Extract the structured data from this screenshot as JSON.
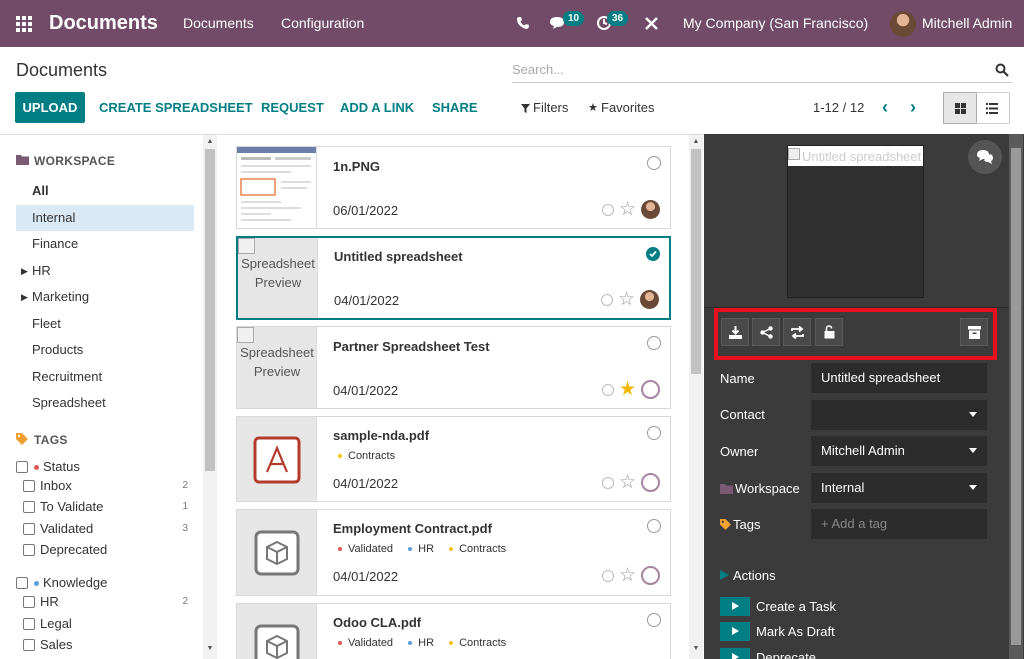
{
  "navbar": {
    "app_name": "Documents",
    "menu": [
      "Documents",
      "Configuration"
    ],
    "messages_count": "10",
    "activities_count": "36",
    "company": "My Company (San Francisco)",
    "user": "Mitchell Admin"
  },
  "control_panel": {
    "title": "Documents",
    "search_placeholder": "Search...",
    "upload_label": "UPLOAD",
    "links": [
      "CREATE SPREADSHEET",
      "REQUEST",
      "ADD A LINK",
      "SHARE"
    ],
    "filters_label": "Filters",
    "favorites_label": "Favorites",
    "pager": "1-12 / 12"
  },
  "sidebar": {
    "workspace_heading": "WORKSPACE",
    "folders": [
      {
        "label": "All",
        "bold": true
      },
      {
        "label": "Internal",
        "active": true
      },
      {
        "label": "Finance"
      },
      {
        "label": "HR",
        "has_children": true
      },
      {
        "label": "Marketing",
        "has_children": true
      },
      {
        "label": "Fleet"
      },
      {
        "label": "Products"
      },
      {
        "label": "Recruitment"
      },
      {
        "label": "Spreadsheet"
      }
    ],
    "tags_heading": "TAGS",
    "tag_groups": [
      {
        "name": "Status",
        "color": "#e05a5a",
        "tags": [
          {
            "label": "Inbox",
            "count": "2"
          },
          {
            "label": "To Validate",
            "count": "1"
          },
          {
            "label": "Validated",
            "count": "3"
          },
          {
            "label": "Deprecated",
            "count": ""
          }
        ]
      },
      {
        "name": "Knowledge",
        "color": "#5aa0e0",
        "tags": [
          {
            "label": "HR",
            "count": "2"
          },
          {
            "label": "Legal",
            "count": ""
          },
          {
            "label": "Sales",
            "count": ""
          }
        ]
      }
    ]
  },
  "documents": [
    {
      "name": "1n.PNG",
      "date": "06/01/2022",
      "thumb": "image",
      "selected": false,
      "starred": false,
      "owner_avatar": true,
      "tags": []
    },
    {
      "name": "Untitled spreadsheet",
      "date": "04/01/2022",
      "thumb": "spreadsheet",
      "thumb_text": "Spreadsheet Preview",
      "selected": true,
      "starred": false,
      "owner_avatar": true,
      "tags": []
    },
    {
      "name": "Partner Spreadsheet Test",
      "date": "04/01/2022",
      "thumb": "spreadsheet",
      "thumb_text": "Spreadsheet Preview",
      "selected": false,
      "starred": true,
      "owner_avatar": false,
      "tags": []
    },
    {
      "name": "sample-nda.pdf",
      "date": "04/01/2022",
      "thumb": "pdf",
      "selected": false,
      "starred": false,
      "owner_avatar": false,
      "tags": [
        {
          "label": "Contracts",
          "color": "#f0c419"
        }
      ]
    },
    {
      "name": "Employment Contract.pdf",
      "date": "04/01/2022",
      "thumb": "box",
      "selected": false,
      "starred": false,
      "owner_avatar": false,
      "tags": [
        {
          "label": "Validated",
          "color": "#e05a5a"
        },
        {
          "label": "HR",
          "color": "#5aa0e0"
        },
        {
          "label": "Contracts",
          "color": "#f0c419"
        }
      ]
    },
    {
      "name": "Odoo CLA.pdf",
      "date": "",
      "thumb": "box",
      "selected": false,
      "starred": false,
      "owner_avatar": false,
      "tags": [
        {
          "label": "Validated",
          "color": "#e05a5a"
        },
        {
          "label": "HR",
          "color": "#5aa0e0"
        },
        {
          "label": "Contracts",
          "color": "#f0c419"
        }
      ]
    }
  ],
  "inspector": {
    "preview_alt": "Untitled spreadsheet",
    "fields": {
      "name_label": "Name",
      "name_value": "Untitled spreadsheet",
      "contact_label": "Contact",
      "contact_value": "",
      "owner_label": "Owner",
      "owner_value": "Mitchell Admin",
      "workspace_label": "Workspace",
      "workspace_value": "Internal",
      "tags_label": "Tags",
      "tags_placeholder": "+ Add a tag"
    },
    "actions_heading": "Actions",
    "actions": [
      "Create a Task",
      "Mark As Draft",
      "Deprecate"
    ]
  },
  "colors": {
    "navbar": "#714B67",
    "accent": "#017e84",
    "highlight_box": "#e8101f",
    "star": "#f3b800"
  }
}
